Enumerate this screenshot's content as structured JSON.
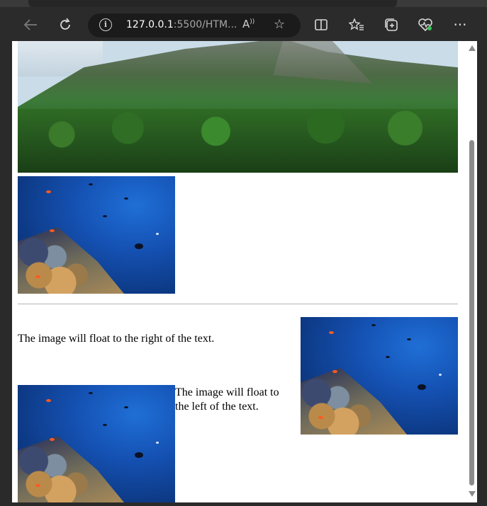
{
  "browser": {
    "url_host": "127.0.0.1",
    "url_rest": ":5500/HTM...",
    "icons": {
      "back": "back-arrow-icon",
      "refresh": "refresh-icon",
      "info": "info-icon",
      "read_aloud": "read-aloud-icon",
      "favorite": "favorite-star-icon",
      "split": "split-screen-icon",
      "favorites_list": "favorites-list-icon",
      "collections": "collections-icon",
      "health": "browser-essentials-icon",
      "more": "more-icon"
    }
  },
  "page": {
    "right_float_text": "The image will float to the right of the text.",
    "left_float_text": "The image will float to the left of the text."
  },
  "colors": {
    "chrome": "#2b2b2b",
    "address_bar": "#1b1b1b",
    "page_background": "#ffffff",
    "divider": "#b5b5b5"
  }
}
